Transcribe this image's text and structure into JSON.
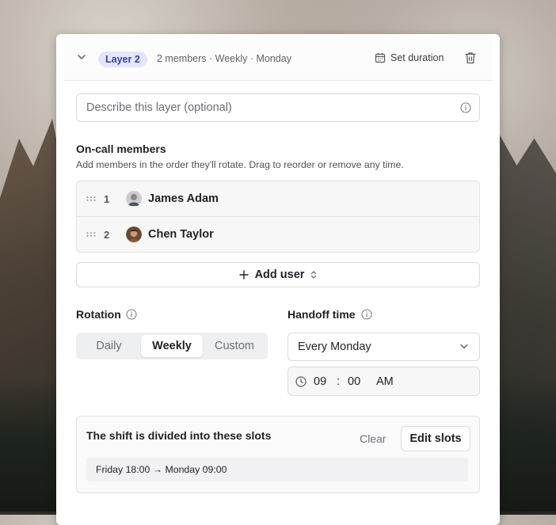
{
  "layer": {
    "badge": "Layer 2",
    "summary": "2 members · Weekly · Monday",
    "set_duration_label": "Set duration"
  },
  "description": {
    "placeholder": "Describe this layer (optional)",
    "value": ""
  },
  "members_section": {
    "title": "On-call members",
    "subtitle": "Add members in the order they'll rotate. Drag to reorder or remove any time.",
    "members": [
      {
        "order": "1",
        "name": "James Adam"
      },
      {
        "order": "2",
        "name": "Chen Taylor"
      }
    ],
    "add_user_label": "Add user"
  },
  "rotation": {
    "label": "Rotation",
    "options": [
      "Daily",
      "Weekly",
      "Custom"
    ],
    "selected": "Weekly"
  },
  "handoff": {
    "label": "Handoff time",
    "day": "Every Monday",
    "hour": "09",
    "separator": ":",
    "minute": "00",
    "meridiem": "AM"
  },
  "slots": {
    "title": "The shift is divided into these slots",
    "clear_label": "Clear",
    "edit_label": "Edit slots",
    "items": [
      "Friday 18:00 → Monday 09:00"
    ]
  },
  "colors": {
    "badge_bg": "#e4e5fb",
    "badge_text": "#3a3f9e"
  },
  "icons": [
    "chevron-down-icon",
    "calendar-icon",
    "trash-icon",
    "info-icon",
    "drag-handle-icon",
    "plus-icon",
    "chevron-updown-icon",
    "clock-icon"
  ]
}
